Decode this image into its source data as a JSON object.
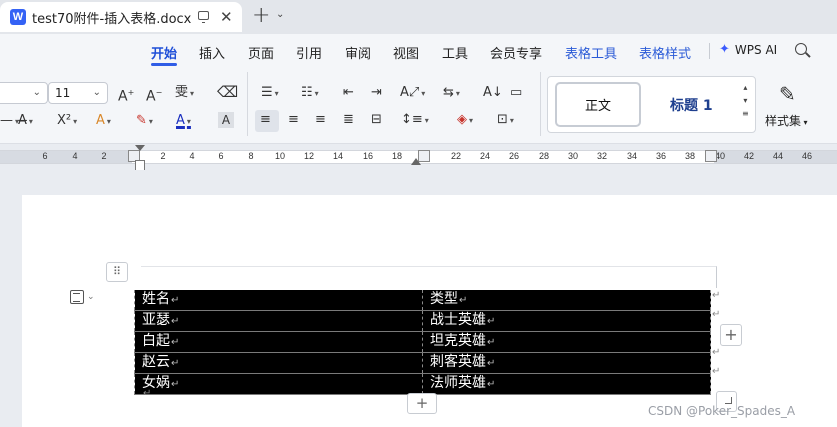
{
  "window": {
    "tab_title": "test70附件-插入表格.docx",
    "app_logo": "W",
    "new_tab_label": "+"
  },
  "menu": {
    "items": [
      {
        "label": "开始",
        "active": true
      },
      {
        "label": "插入"
      },
      {
        "label": "页面"
      },
      {
        "label": "引用"
      },
      {
        "label": "审阅"
      },
      {
        "label": "视图"
      },
      {
        "label": "工具"
      },
      {
        "label": "会员专享"
      },
      {
        "label": "表格工具",
        "contextual": true
      },
      {
        "label": "表格样式",
        "contextual": true
      }
    ],
    "wps_ai": "WPS AI"
  },
  "toolbar": {
    "font_name": "",
    "font_size": "11",
    "grow_font": "A⁺",
    "shrink_font": "A⁻",
    "phonetic": "㊦",
    "superscript": "X²",
    "styles_set_label": "样式集"
  },
  "styles": {
    "normal": "正文",
    "heading1": "标题 1"
  },
  "ruler": {
    "numbers": [
      "6",
      "4",
      "2",
      "2",
      "4",
      "6",
      "8",
      "10",
      "12",
      "14",
      "16",
      "18",
      "22",
      "24",
      "26",
      "28",
      "30",
      "32",
      "34",
      "36",
      "38",
      "40",
      "42",
      "44",
      "46"
    ]
  },
  "table": {
    "rows": [
      [
        "姓名",
        "类型"
      ],
      [
        "亚瑟",
        "战士英雄"
      ],
      [
        "白起",
        "坦克英雄"
      ],
      [
        "赵云",
        "刺客英雄"
      ],
      [
        "女娲",
        "法师英雄"
      ]
    ]
  },
  "paragraph_mark": "↵",
  "add_symbol": "+",
  "watermark": "CSDN @Poker_Spades_A",
  "colors": {
    "accent": "#2f5de6",
    "table_fill": "#000000",
    "table_text": "#ffffff"
  }
}
